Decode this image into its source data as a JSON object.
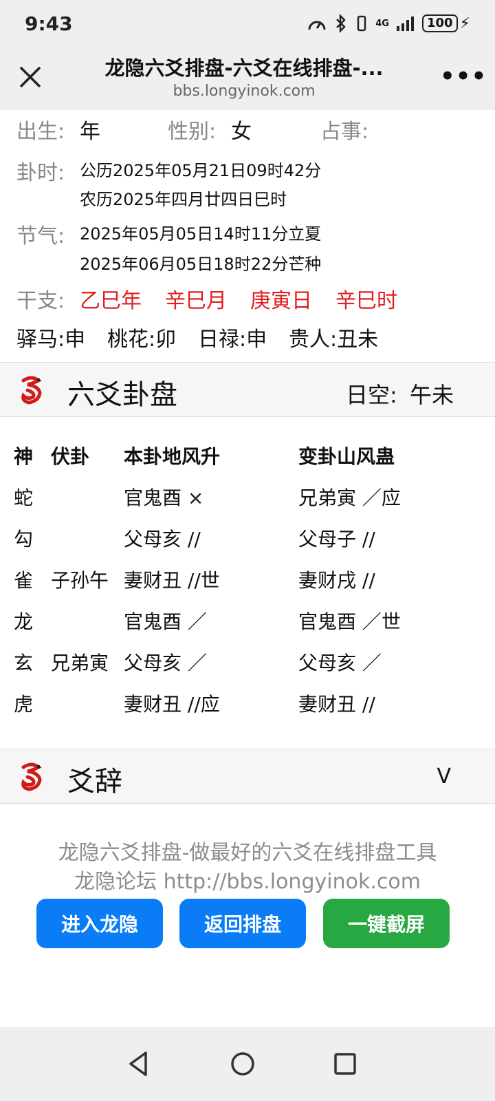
{
  "status_bar": {
    "time": "9:43",
    "network": "4G",
    "battery": "100"
  },
  "browser": {
    "title": "龙隐六爻排盘-六爻在线排盘-...",
    "url": "bbs.longyinok.com"
  },
  "info": {
    "birth_label": "出生:",
    "birth_value": "年",
    "gender_label": "性别:",
    "gender_value": "女",
    "matter_label": "占事:",
    "time_label": "卦时:",
    "solar": "公历2025年05月21日09时42分",
    "lunar": "农历2025年四月廿四日巳时",
    "term_label": "节气:",
    "term1": "2025年05月05日14时11分立夏",
    "term2": "2025年06月05日18时22分芒种",
    "ganzhi_label": "干支:",
    "ganzhi": [
      "乙巳年",
      "辛巳月",
      "庚寅日",
      "辛巳时"
    ],
    "stars": [
      "驿马:申",
      "桃花:卯",
      "日禄:申",
      "贵人:丑未"
    ]
  },
  "gua_section": {
    "title": "六爻卦盘",
    "empty_label": "日空:",
    "empty_value": "午未"
  },
  "gua_table": {
    "headers": [
      "神",
      "伏卦",
      "本卦地风升",
      "变卦山风蛊"
    ],
    "rows": [
      {
        "shen": "蛇",
        "fu": "",
        "ben": "官鬼酉 ×",
        "bian": "兄弟寅 ／应"
      },
      {
        "shen": "勾",
        "fu": "",
        "ben": "父母亥 //",
        "bian": "父母子 //"
      },
      {
        "shen": "雀",
        "fu": "子孙午",
        "ben": "妻财丑 //世",
        "bian": "妻财戌 //"
      },
      {
        "shen": "龙",
        "fu": "",
        "ben": "官鬼酉 ／",
        "bian": "官鬼酉 ／世"
      },
      {
        "shen": "玄",
        "fu": "兄弟寅",
        "ben": "父母亥 ／",
        "bian": "父母亥 ／"
      },
      {
        "shen": "虎",
        "fu": "",
        "ben": "妻财丑 //应",
        "bian": "妻财丑 //"
      }
    ]
  },
  "yaoci_section": {
    "title": "爻辞",
    "toggle": "V"
  },
  "footer": {
    "line1": "龙隐六爻排盘-做最好的六爻在线排盘工具",
    "line2": "龙隐论坛 http://bbs.longyinok.com",
    "btn_enter": "进入龙隐",
    "btn_back": "返回排盘",
    "btn_capture": "一键截屏"
  },
  "colors": {
    "red": "#e41c1c",
    "blue": "#0a7cf5",
    "green": "#27a843"
  }
}
